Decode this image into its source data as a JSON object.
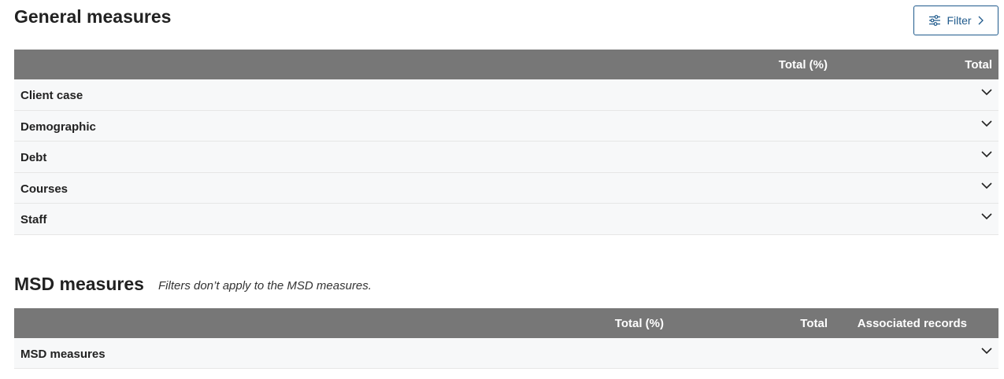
{
  "general": {
    "title": "General measures",
    "filter_label": "Filter",
    "columns": {
      "pct": "Total (%)",
      "total": "Total"
    },
    "rows": [
      "Client case",
      "Demographic",
      "Debt",
      "Courses",
      "Staff"
    ]
  },
  "msd": {
    "title": "MSD measures",
    "note": "Filters don’t apply to the MSD measures.",
    "columns": {
      "pct": "Total (%)",
      "total": "Total",
      "associated": "Associated records"
    },
    "rows": [
      "MSD measures"
    ]
  },
  "colors": {
    "header_bg": "#777777",
    "row_bg": "#f7f8f9",
    "accent": "#1f5a8c"
  }
}
